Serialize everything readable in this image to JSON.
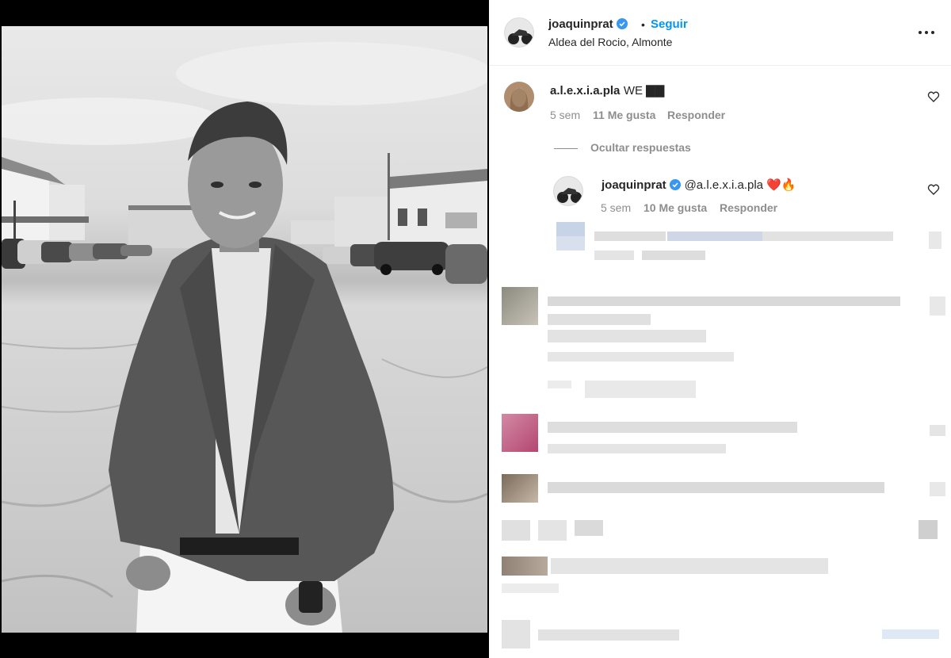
{
  "post": {
    "username": "joaquinprat",
    "follow_label": "Seguir",
    "separator": "•",
    "location": "Aldea del Rocio, Almonte"
  },
  "comments": [
    {
      "username": "a.l.e.x.i.a.pla",
      "text": "WE ▇▇",
      "time": "5 sem",
      "likes": "11 Me gusta",
      "reply_label": "Responder"
    }
  ],
  "hide_replies_label": "Ocultar respuestas",
  "replies": [
    {
      "username": "joaquinprat",
      "text": "@a.l.e.x.i.a.pla ❤️🔥",
      "time": "5 sem",
      "likes": "10 Me gusta",
      "reply_label": "Responder"
    }
  ],
  "colors": {
    "link_blue": "#0095f6",
    "verified_blue": "#3897f0",
    "muted": "#8e8e8e",
    "text": "#262626"
  },
  "icons": [
    "verified-icon",
    "more-options-icon",
    "heart-icon"
  ]
}
